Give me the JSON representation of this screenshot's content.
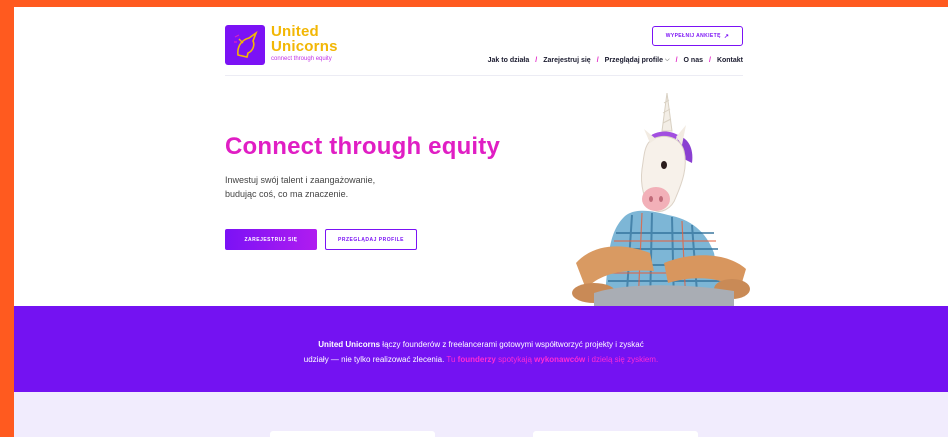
{
  "brand": {
    "line1": "United",
    "line2": "Unicorns",
    "tagline": "connect through equity",
    "logo_icon": "unicorn-logo-icon",
    "primary_color": "#7b12f5",
    "accent_pink": "#e01ec4",
    "logo_yellow": "#f2b705"
  },
  "header": {
    "survey_label": "WYPEŁNIJ ANKIETĘ",
    "nav": [
      {
        "label": "Jak to działa"
      },
      {
        "label": "Zarejestruj się"
      },
      {
        "label": "Przeglądaj profile"
      },
      {
        "label": "O nas"
      },
      {
        "label": "Kontakt"
      }
    ]
  },
  "hero": {
    "title": "Connect through equity",
    "subtitle_line1": "Inwestuj swój talent i zaangażowanie,",
    "subtitle_line2": "budując coś, co ma znaczenie.",
    "primary_cta": "ZAREJESTRUJ SIĘ",
    "secondary_cta": "PRZEGLĄDAJ PROFILE"
  },
  "band": {
    "brand": "United Unicorns",
    "text1": " łączy founderów z freelancerami gotowymi współtworzyć projekty i zyskać",
    "text2": "udziały — nie tylko realizować zlecenia. ",
    "pink1": "Tu ",
    "founders": "founderzy",
    "pink2": " spotykają ",
    "contractors": "wykonawców",
    "pink3": " i dzielą się zyskiem."
  }
}
